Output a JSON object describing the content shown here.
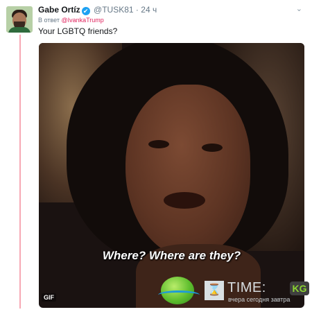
{
  "tweet": {
    "author_name": "Gabe Ortíz",
    "handle": "@TUSK81",
    "time": "24 ч",
    "reply_prefix": "В ответ",
    "reply_mention": "@IvankaTrump",
    "text": "Your LGBTQ friends?",
    "verified_icon": "✔",
    "menu_icon": "⌄"
  },
  "media": {
    "caption": "Where? Where are they?",
    "badge": "GIF"
  },
  "watermark": {
    "brand": "TIME:",
    "logo": "KG",
    "tagline": "вчера сегодня завтра",
    "hourglass_icon": "⌛"
  },
  "colors": {
    "verified": "#1da1f2",
    "mention": "#e0245e",
    "thread_line": "#f7a8b4"
  }
}
